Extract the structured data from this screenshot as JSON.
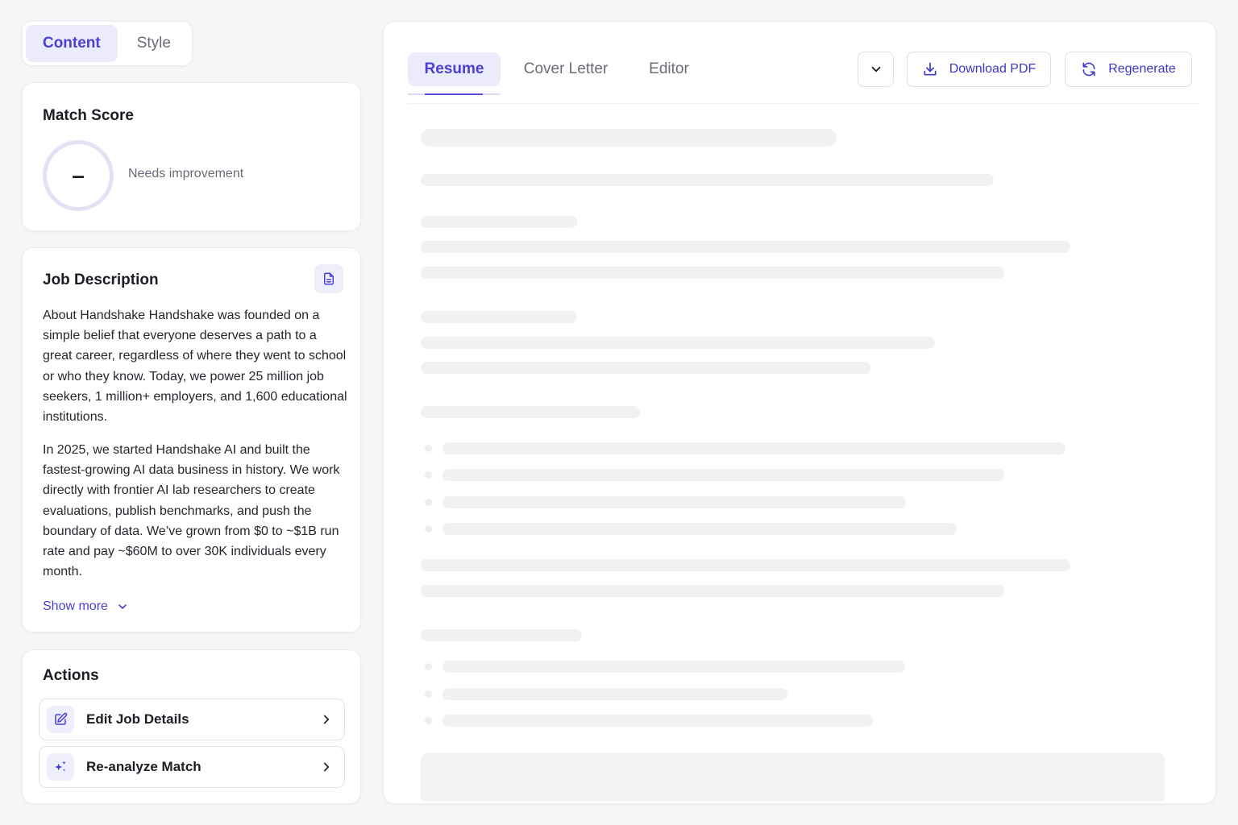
{
  "modeToggle": {
    "content": "Content",
    "style": "Style"
  },
  "matchScore": {
    "title": "Match Score",
    "value": "–",
    "status": "Needs improvement"
  },
  "jobDescription": {
    "title": "Job Description",
    "paragraphs": [
      "About Handshake Handshake was founded on a simple belief that everyone deserves a path to a great career, regardless of where they went to school or who they know. Today, we power 25 million job seekers, 1 million+ employers, and 1,600 educational institutions.",
      "In 2025, we started Handshake AI and built the fastest-growing AI data business in history. We work directly with frontier AI lab researchers to create evaluations, publish benchmarks, and push the boundary of data. We’ve grown from $0 to ~$1B run rate and pay ~$60M to over 30K individuals every month."
    ],
    "showMore": "Show more"
  },
  "actions": {
    "title": "Actions",
    "items": [
      {
        "label": "Edit Job Details",
        "icon": "edit-icon"
      },
      {
        "label": "Re-analyze Match",
        "icon": "sparkles-icon"
      }
    ]
  },
  "docTabs": {
    "tabs": [
      "Resume",
      "Cover Letter",
      "Editor"
    ],
    "active": "Resume"
  },
  "toolbar": {
    "download": "Download PDF",
    "regenerate": "Regenerate"
  },
  "colors": {
    "accent": "#4b3fd8",
    "accentBg": "#ecebfb",
    "background": "#f6f6f8",
    "skeleton": "#f1f1f4"
  }
}
